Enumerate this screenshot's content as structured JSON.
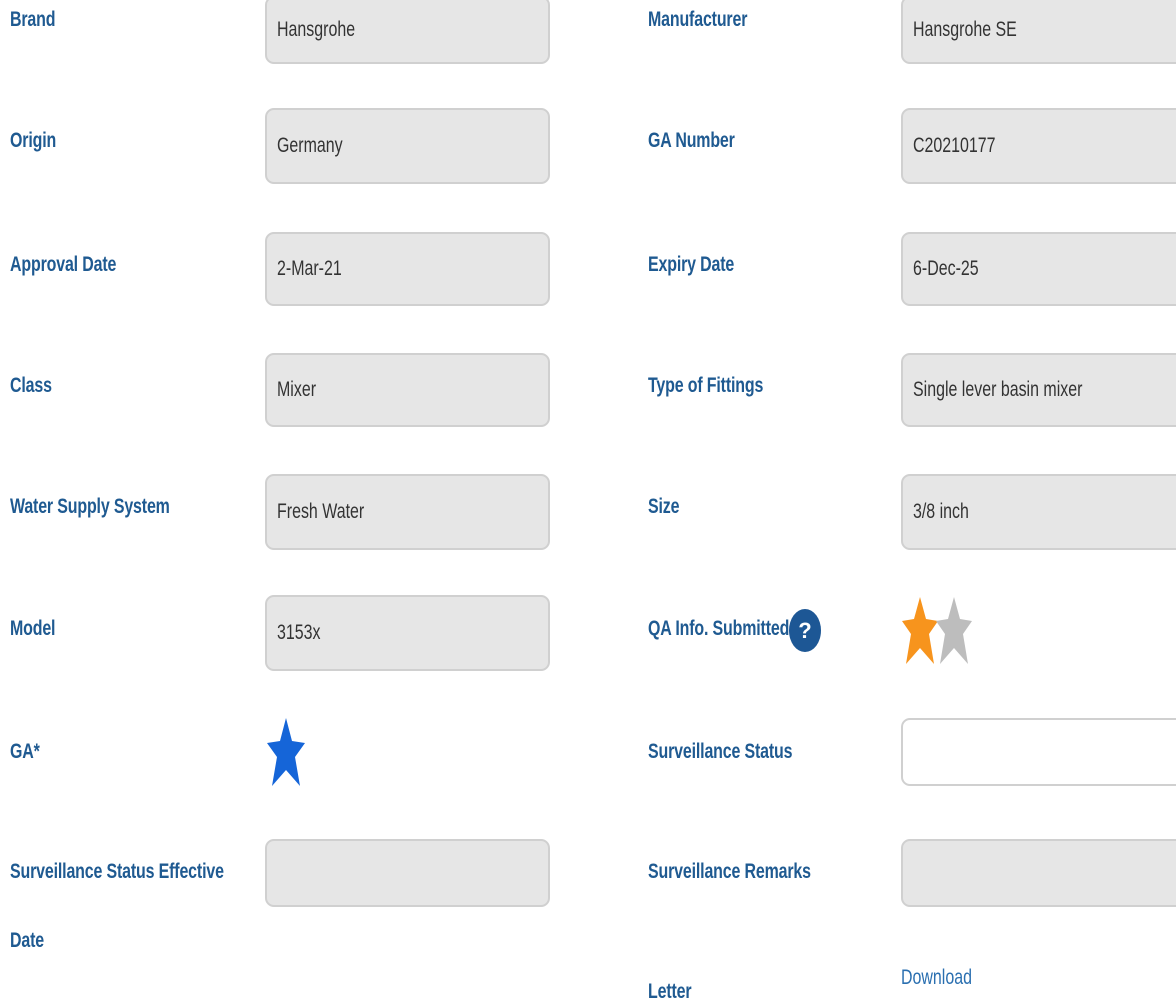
{
  "fields": {
    "brand": {
      "label": "Brand",
      "value": "Hansgrohe"
    },
    "manufacturer": {
      "label": "Manufacturer",
      "value": "Hansgrohe SE"
    },
    "origin": {
      "label": "Origin",
      "value": "Germany"
    },
    "ga_number": {
      "label": "GA Number",
      "value": "C20210177"
    },
    "approval_date": {
      "label": "Approval Date",
      "value": "2-Mar-21"
    },
    "expiry_date": {
      "label": "Expiry Date",
      "value": "6-Dec-25"
    },
    "class": {
      "label": "Class",
      "value": "Mixer"
    },
    "type_of_fittings": {
      "label": "Type of Fittings",
      "value": "Single lever basin mixer"
    },
    "water_supply_system": {
      "label": "Water Supply System",
      "value": "Fresh Water"
    },
    "size": {
      "label": "Size",
      "value": "3/8 inch"
    },
    "model": {
      "label": "Model",
      "value": "3153x"
    },
    "qa_info_submitted": {
      "label": "QA Info. Submitted",
      "help_glyph": "?",
      "rating_icons": [
        "star-orange-icon",
        "star-gray-icon"
      ]
    },
    "ga": {
      "label": "GA*",
      "icon": "star-blue-icon"
    },
    "surveillance_status": {
      "label": "Surveillance Status",
      "value": ""
    },
    "surveillance_status_effective_date": {
      "label_line1": "Surveillance Status Effective",
      "label_line2": "Date",
      "value": ""
    },
    "surveillance_remarks": {
      "label": "Surveillance Remarks",
      "value": ""
    },
    "letter": {
      "label": "Letter",
      "link_text": "Download"
    }
  },
  "colors": {
    "label": "#1f5a91",
    "field_bg": "#e6e6e6",
    "field_border": "#d0d0d0",
    "link": "#2a6fb0",
    "help_bg": "#1d5795",
    "star_blue": "#1565d8",
    "star_orange": "#f7941d",
    "star_gray": "#bdbdbd"
  }
}
